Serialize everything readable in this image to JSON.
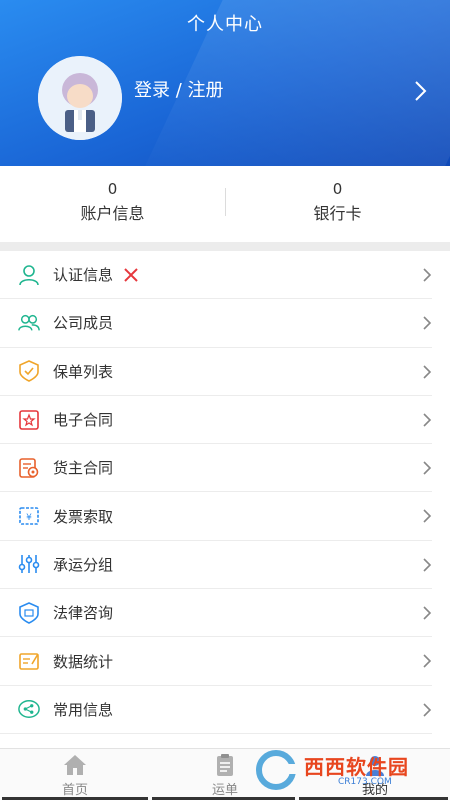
{
  "header": {
    "title": "个人中心",
    "login_label": "登录 / 注册"
  },
  "stats": [
    {
      "value": "0",
      "label": "账户信息"
    },
    {
      "value": "0",
      "label": "银行卡"
    }
  ],
  "menu": [
    {
      "label": "认证信息",
      "icon": "user-outline-icon",
      "badge": "status-x-icon",
      "color": "#1fb58f"
    },
    {
      "label": "公司成员",
      "icon": "group-icon",
      "color": "#1fb58f"
    },
    {
      "label": "保单列表",
      "icon": "shield-check-icon",
      "color": "#f0a52a"
    },
    {
      "label": "电子合同",
      "icon": "contract-seal-icon",
      "color": "#e6373c"
    },
    {
      "label": "货主合同",
      "icon": "cargo-contract-icon",
      "color": "#e8612c"
    },
    {
      "label": "发票索取",
      "icon": "invoice-icon",
      "color": "#2a8cf0"
    },
    {
      "label": "承运分组",
      "icon": "sliders-icon",
      "color": "#2a8cf0"
    },
    {
      "label": "法律咨询",
      "icon": "law-shield-icon",
      "color": "#2a8cf0"
    },
    {
      "label": "数据统计",
      "icon": "statistics-icon",
      "color": "#f0a52a"
    },
    {
      "label": "常用信息",
      "icon": "share-icon",
      "color": "#1fb58f"
    }
  ],
  "tabs": [
    {
      "label": "首页",
      "icon": "home-icon"
    },
    {
      "label": "运单",
      "icon": "clipboard-icon"
    },
    {
      "label": "我的",
      "icon": "profile-icon",
      "active": true
    }
  ],
  "watermark": {
    "text": "西西软件园",
    "sub": "CR173.COM"
  }
}
